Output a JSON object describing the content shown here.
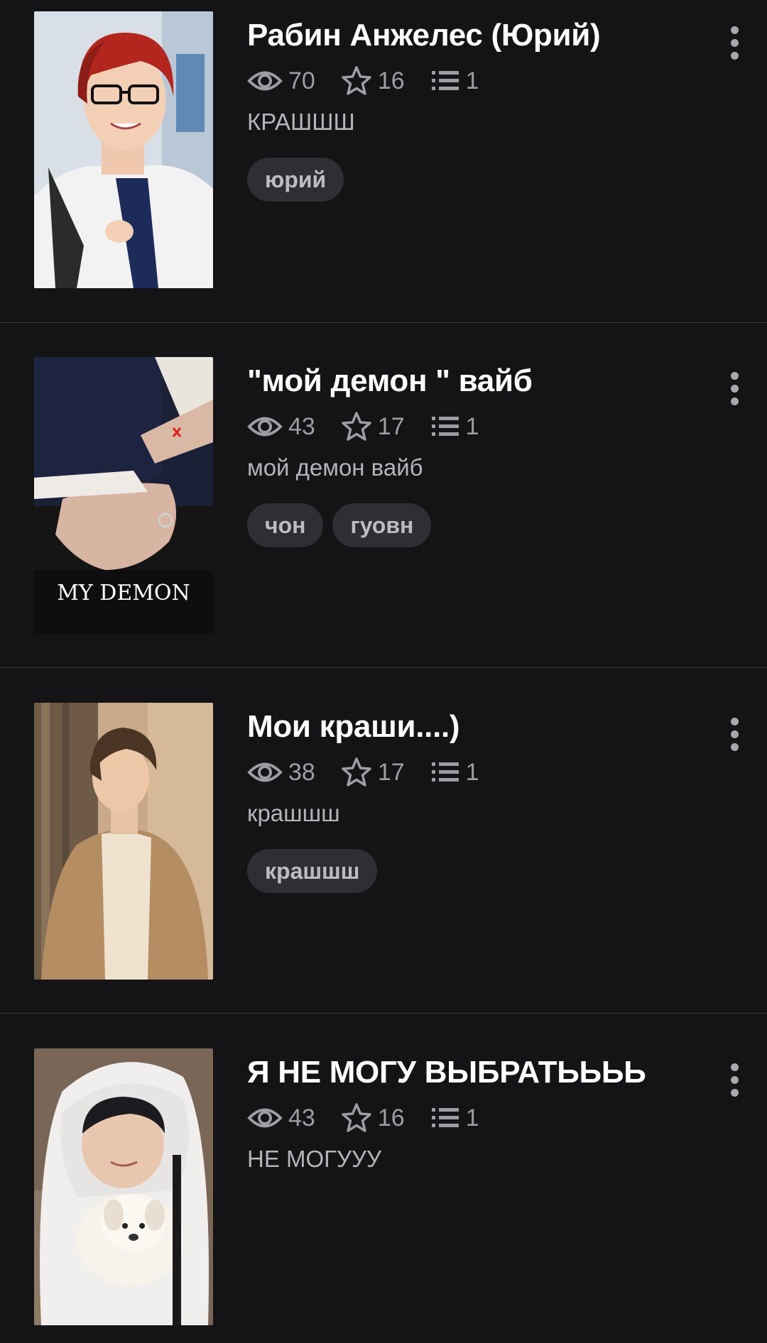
{
  "stories": [
    {
      "title": "Рабин Анжелес (Юрий)",
      "views": "70",
      "votes": "16",
      "parts": "1",
      "description": "КРАШШШ",
      "tags": [
        "юрий"
      ],
      "cover_icon": "red-haired-boy-cover"
    },
    {
      "title": "\"мой демон \" вайб",
      "views": "43",
      "votes": "17",
      "parts": "1",
      "description": "мой демон вайб",
      "tags": [
        "чон",
        "гуовн"
      ],
      "cover_icon": "my-demon-cover",
      "cover_text": "MY DEMON"
    },
    {
      "title": "Мои краши....)",
      "views": "38",
      "votes": "17",
      "parts": "1",
      "description": "крашшш",
      "tags": [
        "крашшш"
      ],
      "cover_icon": "man-in-beige-coat-cover"
    },
    {
      "title": "Я НЕ МОГУ ВЫБРАТЬЬЬЬ",
      "views": "43",
      "votes": "16",
      "parts": "1",
      "description": "НЕ МОГУУУ",
      "tags": [],
      "cover_icon": "boy-with-puppy-cover"
    }
  ],
  "colors": {
    "background": "#141316",
    "title": "#ffffff",
    "stats": "#9e9da2",
    "tag_bg": "#2f2e33",
    "divider": "#3a393d"
  }
}
